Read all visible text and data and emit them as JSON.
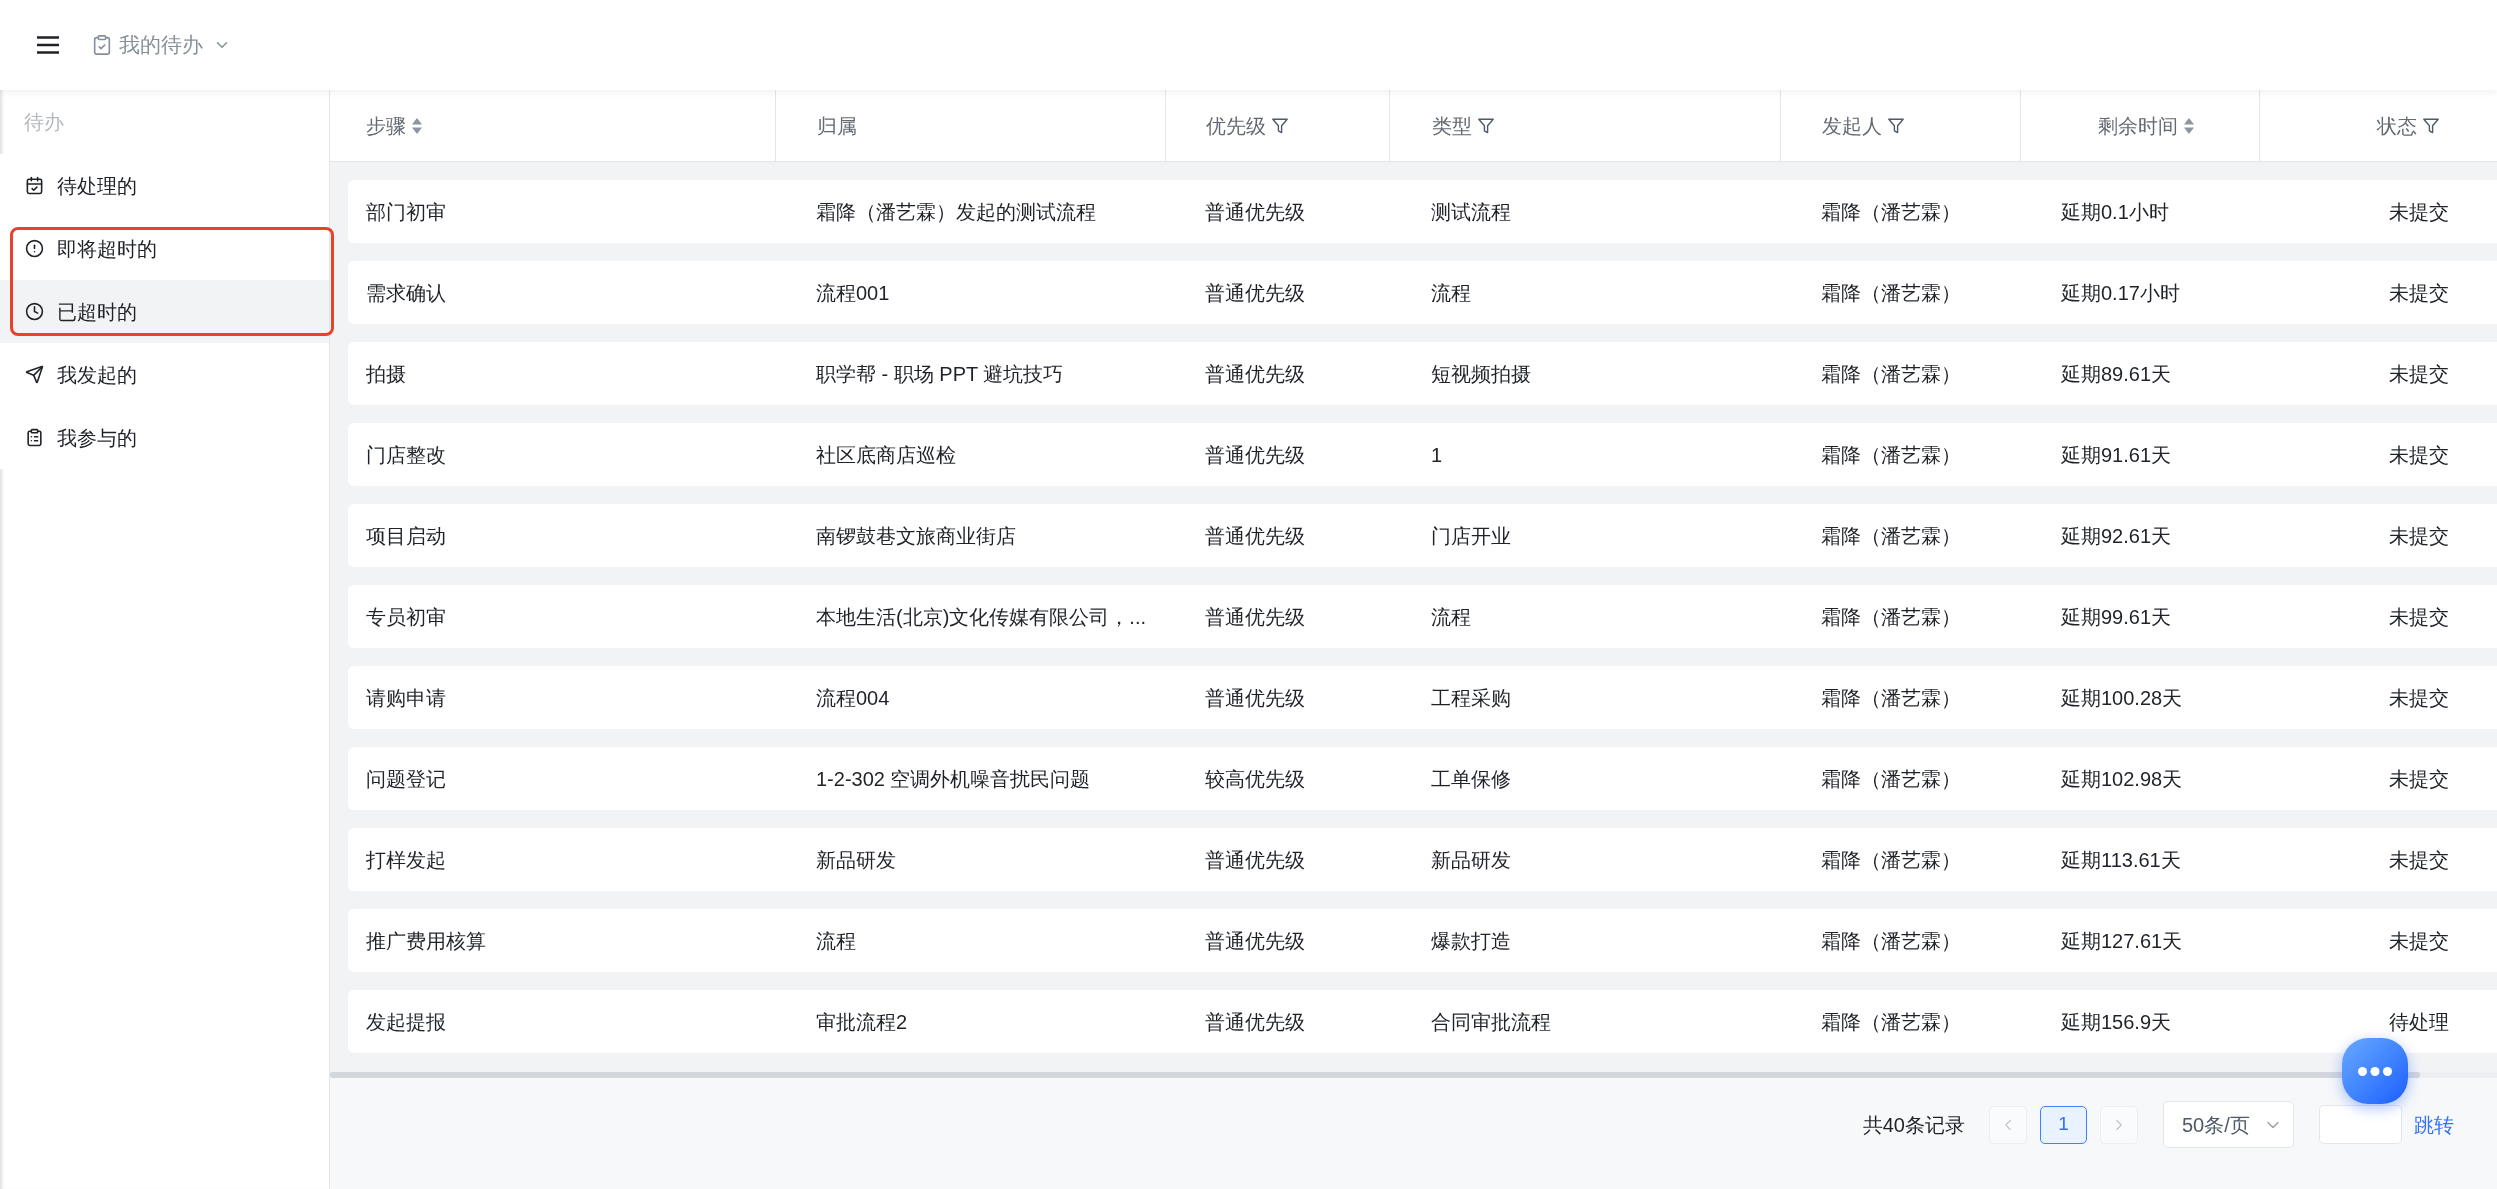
{
  "header": {
    "title": "我的待办"
  },
  "sidebar": {
    "group_label": "待办",
    "items": [
      {
        "label": "待处理的",
        "selected": false,
        "highlighted": false
      },
      {
        "label": "即将超时的",
        "selected": false,
        "highlighted": true
      },
      {
        "label": "已超时的",
        "selected": true,
        "highlighted": true
      },
      {
        "label": "我发起的",
        "selected": false,
        "highlighted": false
      },
      {
        "label": "我参与的",
        "selected": false,
        "highlighted": false
      }
    ]
  },
  "table": {
    "columns": [
      {
        "label": "步骤",
        "sortable": true,
        "filterable": false
      },
      {
        "label": "归属",
        "sortable": false,
        "filterable": false
      },
      {
        "label": "优先级",
        "sortable": false,
        "filterable": true
      },
      {
        "label": "类型",
        "sortable": false,
        "filterable": true
      },
      {
        "label": "发起人",
        "sortable": false,
        "filterable": true
      },
      {
        "label": "剩余时间",
        "sortable": true,
        "filterable": false
      },
      {
        "label": "状态",
        "sortable": false,
        "filterable": true
      }
    ],
    "rows": [
      [
        "部门初审",
        "霜降（潘艺霖）发起的测试流程",
        "普通优先级",
        "测试流程",
        "霜降（潘艺霖）",
        "延期0.1小时",
        "未提交"
      ],
      [
        "需求确认",
        "流程001",
        "普通优先级",
        "流程",
        "霜降（潘艺霖）",
        "延期0.17小时",
        "未提交"
      ],
      [
        "拍摄",
        "职学帮 - 职场 PPT 避坑技巧",
        "普通优先级",
        "短视频拍摄",
        "霜降（潘艺霖）",
        "延期89.61天",
        "未提交"
      ],
      [
        "门店整改",
        "社区底商店巡检",
        "普通优先级",
        "1",
        "霜降（潘艺霖）",
        "延期91.61天",
        "未提交"
      ],
      [
        "项目启动",
        "南锣鼓巷文旅商业街店",
        "普通优先级",
        "门店开业",
        "霜降（潘艺霖）",
        "延期92.61天",
        "未提交"
      ],
      [
        "专员初审",
        "本地生活(北京)文化传媒有限公司，...",
        "普通优先级",
        "流程",
        "霜降（潘艺霖）",
        "延期99.61天",
        "未提交"
      ],
      [
        "请购申请",
        "流程004",
        "普通优先级",
        "工程采购",
        "霜降（潘艺霖）",
        "延期100.28天",
        "未提交"
      ],
      [
        "问题登记",
        "1-2-302 空调外机噪音扰民问题",
        "较高优先级",
        "工单保修",
        "霜降（潘艺霖）",
        "延期102.98天",
        "未提交"
      ],
      [
        "打样发起",
        "新品研发",
        "普通优先级",
        "新品研发",
        "霜降（潘艺霖）",
        "延期113.61天",
        "未提交"
      ],
      [
        "推广费用核算",
        "流程",
        "普通优先级",
        "爆款打造",
        "霜降（潘艺霖）",
        "延期127.61天",
        "未提交"
      ],
      [
        "发起提报",
        "审批流程2",
        "普通优先级",
        "合同审批流程",
        "霜降（潘艺霖）",
        "延期156.9天",
        "待处理"
      ]
    ]
  },
  "pagination": {
    "total": "共40条记录",
    "prev": {
      "disabled": true
    },
    "pages": [
      {
        "label": "1",
        "selected": true
      }
    ],
    "next": {
      "disabled": true
    },
    "page_size": "50条/页",
    "jump_label": "跳转"
  }
}
